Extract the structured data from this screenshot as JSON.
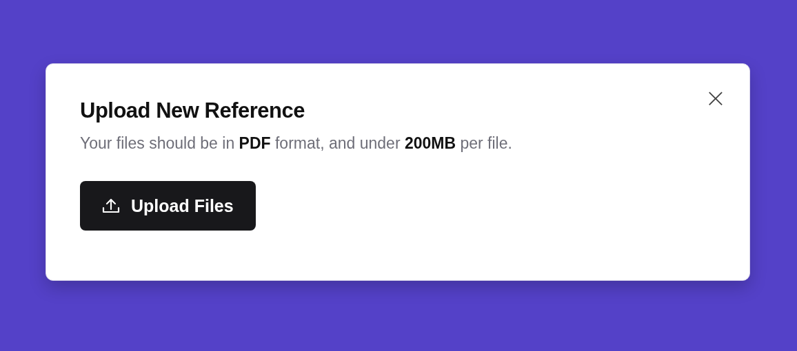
{
  "dialog": {
    "title": "Upload New Reference",
    "description": "Your files should be in **PDF** format, and under **200MB** per file.",
    "close_label": "×",
    "upload_button": {
      "label": "Upload Files"
    }
  }
}
